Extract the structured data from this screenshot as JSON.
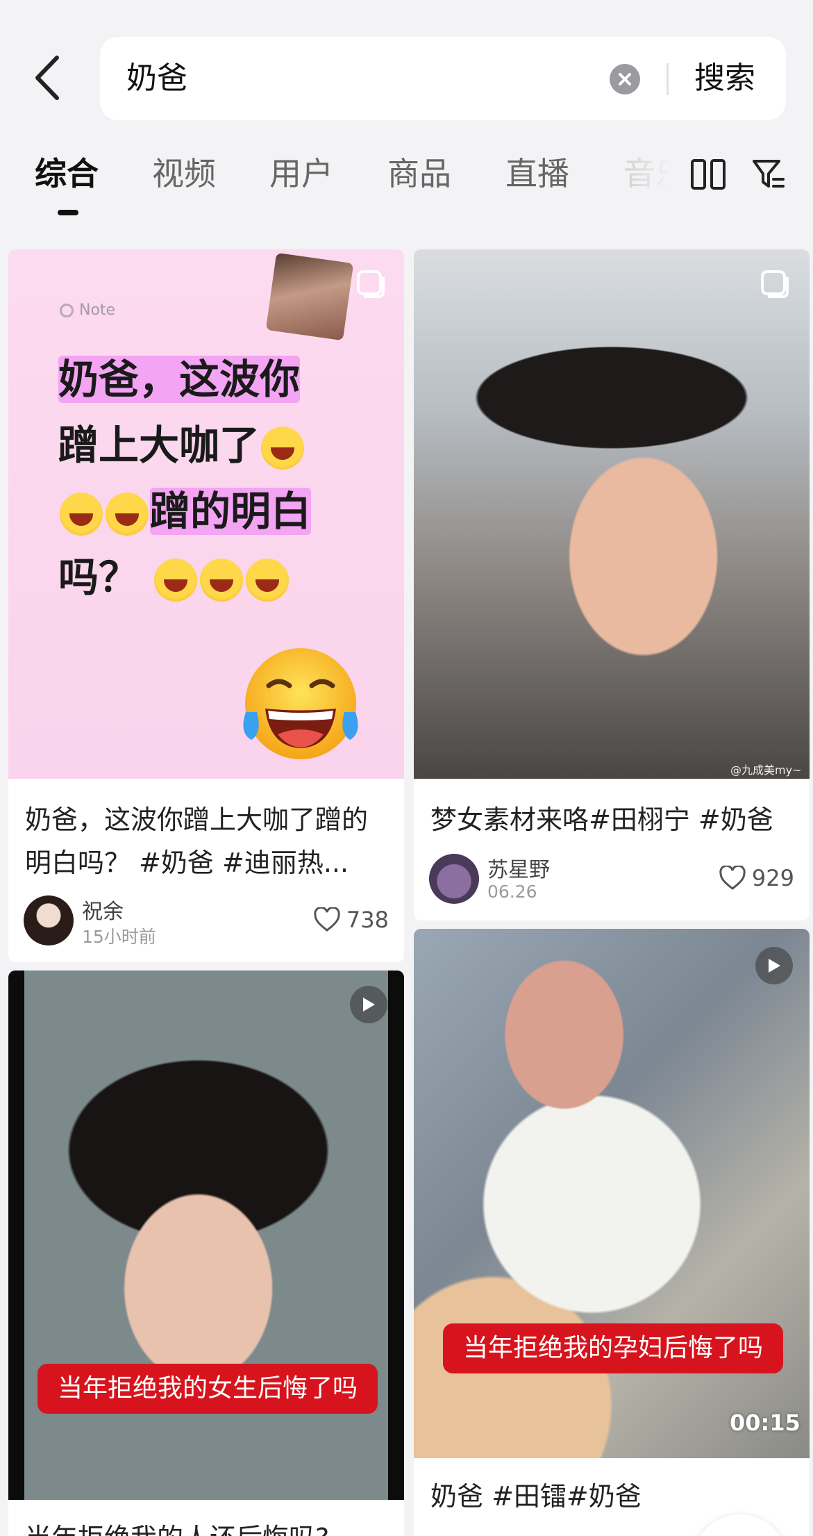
{
  "search": {
    "query": "奶爸",
    "submit_label": "搜索"
  },
  "tabs": [
    {
      "label": "综合",
      "active": true
    },
    {
      "label": "视频",
      "active": false
    },
    {
      "label": "用户",
      "active": false
    },
    {
      "label": "商品",
      "active": false
    },
    {
      "label": "直播",
      "active": false
    },
    {
      "label": "音乐",
      "active": false
    }
  ],
  "toolbar_icons": [
    "layout-toggle-icon",
    "filter-icon"
  ],
  "cards": [
    {
      "kind": "note",
      "note_badge": "Note",
      "note_lines": [
        "奶爸，这波你",
        "蹭上大咖了",
        "蹭的明白",
        "吗？"
      ],
      "title": "奶爸，这波你蹭上大咖了蹭的明白吗？ #奶爸 #迪丽热...",
      "author": "祝余",
      "time": "15小时前",
      "likes": "738"
    },
    {
      "kind": "image",
      "watermark": "@九成美my~",
      "title": "梦女素材来咯#田栩宁 #奶爸",
      "author": "苏星野",
      "time": "06.26",
      "likes": "929"
    },
    {
      "kind": "video",
      "subtitle": "当年拒绝我的女生后悔了吗",
      "title": "当年拒绝我的人还后悔吗?"
    },
    {
      "kind": "video",
      "subtitle": "当年拒绝我的孕妇后悔了吗",
      "duration": "00:15",
      "title": "奶爸 #田镭#奶爸"
    }
  ],
  "colors": {
    "background": "#f3f3f5",
    "subtitle_red": "#d7141e",
    "note_pink": "#fcd8ee",
    "highlight": "#f3a4f3"
  }
}
